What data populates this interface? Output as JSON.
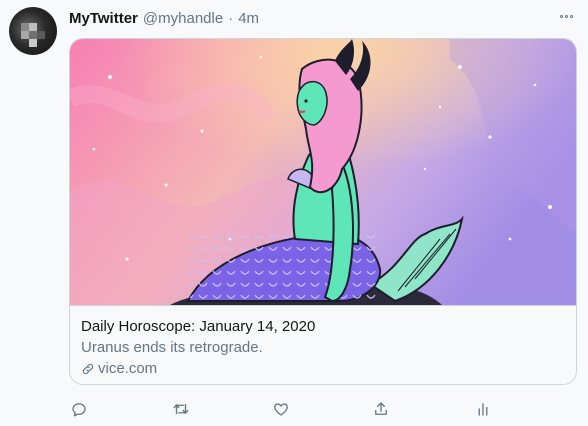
{
  "tweet": {
    "name": "MyTwitter",
    "handle": "@myhandle",
    "separator": "·",
    "time": "4m"
  },
  "card": {
    "title": "Daily Horoscope: January 14, 2020",
    "description": "Uranus ends its retrograde.",
    "domain": "vice.com"
  },
  "icons": {
    "avatar": "avatar",
    "more": "more-icon",
    "link": "link-icon",
    "actions": [
      "reply-icon",
      "retweet-icon",
      "like-icon",
      "share-icon",
      "analytics-icon"
    ]
  },
  "colors": {
    "name": "#14171a",
    "secondary": "#657786",
    "border": "#ccd6dd",
    "background": "#f7f9fa"
  }
}
